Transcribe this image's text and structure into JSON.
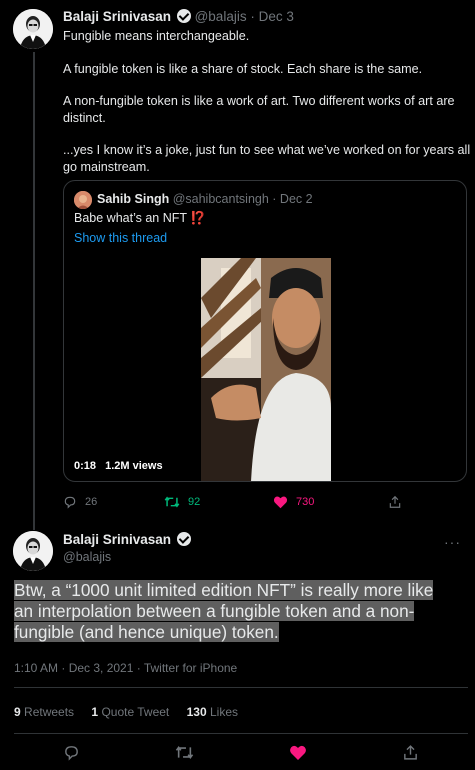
{
  "colors": {
    "accent": "#1d9bf0",
    "like": "#f91880",
    "retweet": "#00ba7c",
    "muted": "#71767b",
    "background": "#000000"
  },
  "tweet1": {
    "author_name": "Balaji Srinivasan",
    "handle": "@balajis",
    "date": "· Dec 3",
    "paragraphs": [
      "Fungible means interchangeable.",
      "A fungible token is like a share of stock. Each share is the same.",
      "A non-fungible token is like a work of art. Two different works of art are distinct.",
      "...yes I know it’s a joke, just fun to see what we’ve worked on for years all go mainstream."
    ],
    "quote": {
      "author_name": "Sahib Singh",
      "handle": "@sahibcantsingh",
      "date": "· Dec 2",
      "text": "Babe what’s an NFT",
      "emoji": "⁉️",
      "show_thread": "Show this thread",
      "video_time": "0:18",
      "video_views": "1.2M views"
    },
    "actions": {
      "replies": "26",
      "retweets": "92",
      "likes": "730"
    }
  },
  "tweet2": {
    "author_name": "Balaji Srinivasan",
    "handle": "@balajis",
    "more": "···",
    "body": "Btw, a “1000 unit limited edition NFT” is really more like an interpolation between a fungible token and a non-fungible (and hence unique) token.",
    "meta": "1:10 AM · Dec 3, 2021 · Twitter for iPhone",
    "stats": {
      "retweets_num": "9",
      "retweets_label": "Retweets",
      "quotes_num": "1",
      "quotes_label": "Quote Tweet",
      "likes_num": "130",
      "likes_label": "Likes"
    }
  },
  "icons": [
    "reply-icon",
    "retweet-icon",
    "like-icon",
    "share-icon",
    "verified-icon"
  ]
}
